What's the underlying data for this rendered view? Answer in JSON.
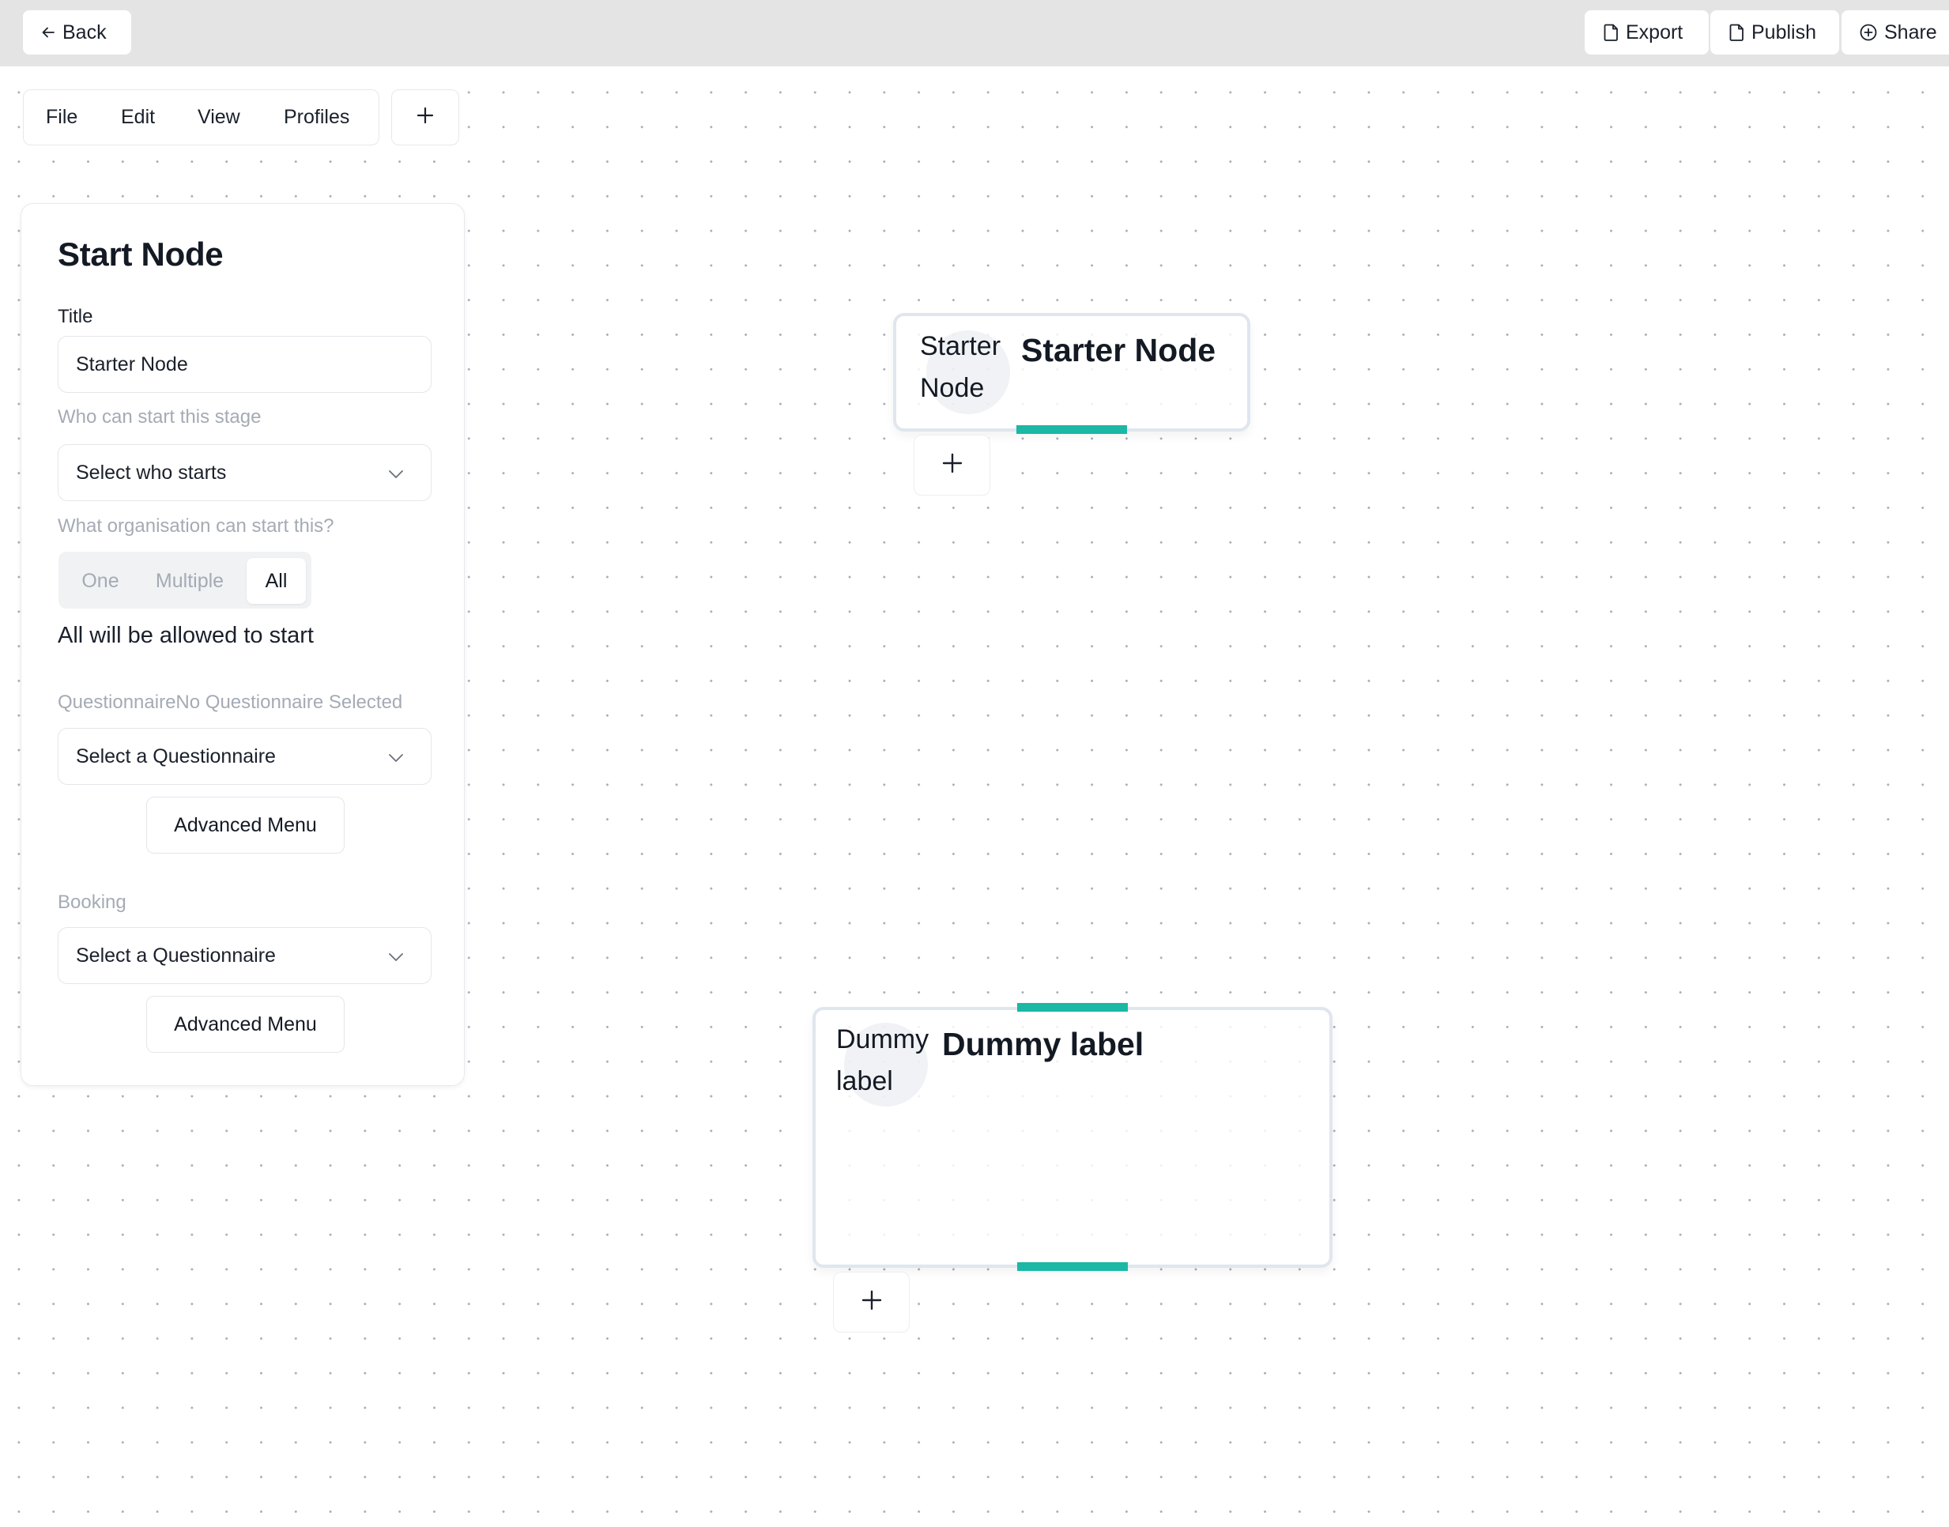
{
  "header": {
    "back_label": "Back",
    "back_icon": "arrow-left-icon",
    "actions": [
      {
        "label": "Export",
        "icon": "file-icon"
      },
      {
        "label": "Publish",
        "icon": "file-icon"
      },
      {
        "label": "Share",
        "icon": "plus-circle-icon"
      }
    ]
  },
  "menubar": {
    "items": [
      "File",
      "Edit",
      "View",
      "Profiles"
    ],
    "add_icon": "plus-icon"
  },
  "panel": {
    "heading": "Start Node",
    "title_label": "Title",
    "title_value": "Starter Node",
    "who_label": "Who can start this stage",
    "who_select": "Select who starts",
    "org_label": "What organisation can start this?",
    "org_options": [
      "One",
      "Multiple",
      "All"
    ],
    "org_selected": "All",
    "org_result": "All will be allowed to start",
    "questionnaire_label": "QuestionnaireNo Questionnaire Selected",
    "questionnaire_select": "Select a Questionnaire",
    "questionnaire_advanced": "Advanced Menu",
    "booking_label": "Booking",
    "booking_select": "Select a Questionnaire",
    "booking_advanced": "Advanced Menu"
  },
  "nodes": [
    {
      "subtitle": "Starter Node",
      "title": "Starter Node"
    },
    {
      "subtitle": "Dummy label",
      "title": "Dummy label"
    }
  ],
  "colors": {
    "accent_teal": "#1ab8a5",
    "header_bg": "#e4e4e4",
    "muted_text": "#a4abb4",
    "text": "#141a24"
  }
}
